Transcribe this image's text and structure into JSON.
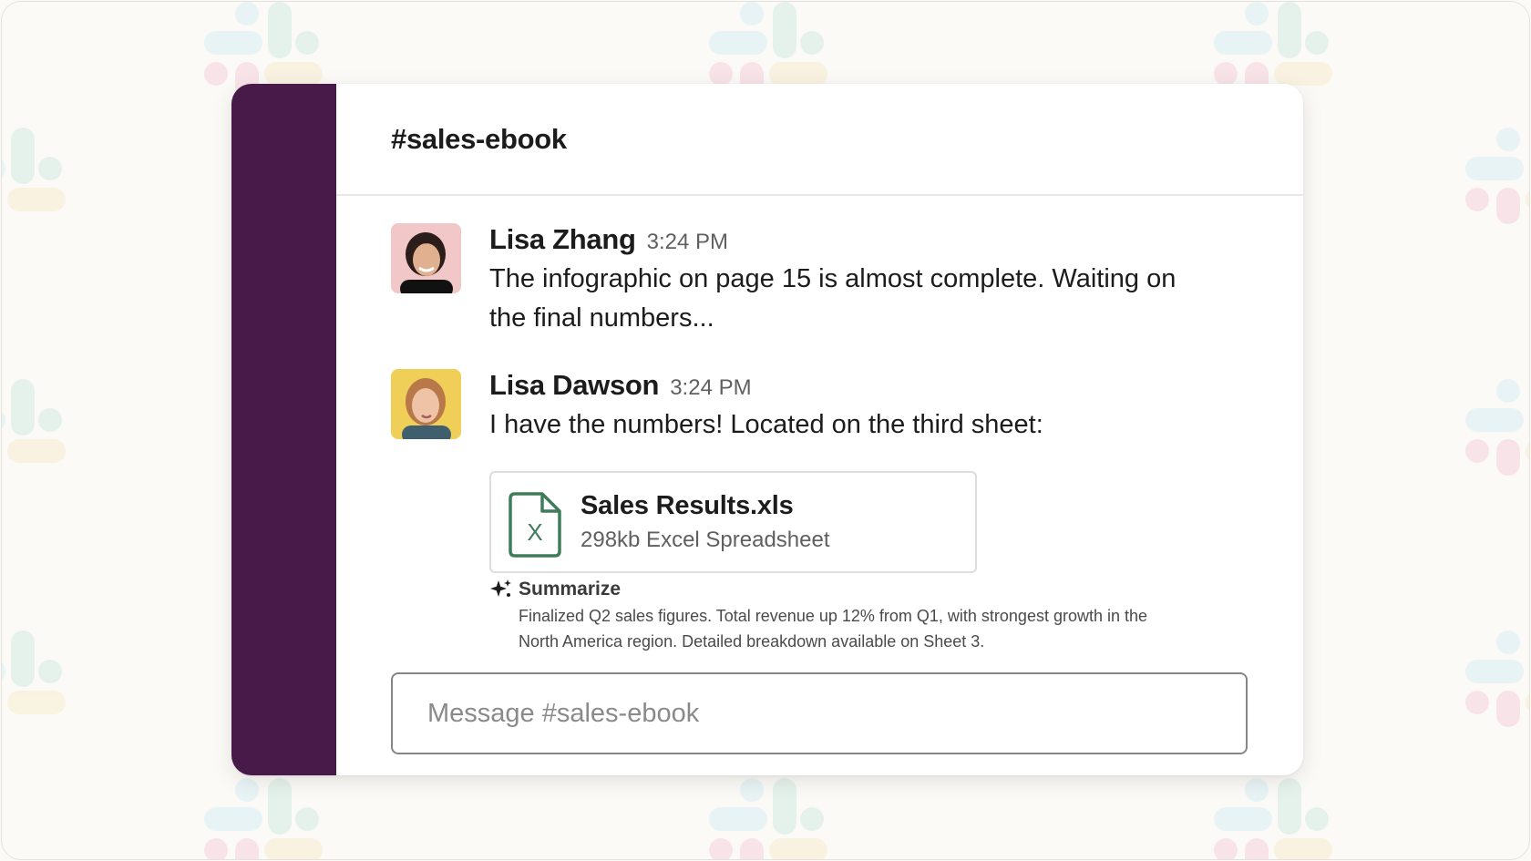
{
  "channel": {
    "name": "#sales-ebook"
  },
  "messages": [
    {
      "sender": "Lisa Zhang",
      "time": "3:24 PM",
      "text": "The infographic on page 15 is almost complete. Waiting on the final numbers..."
    },
    {
      "sender": "Lisa Dawson",
      "time": "3:24 PM",
      "text": "I have the numbers! Located on the third sheet:",
      "attachment": {
        "icon": "excel-file-icon",
        "icon_letter": "X",
        "name": "Sales Results.xls",
        "meta": "298kb Excel Spreadsheet"
      },
      "summary": {
        "icon": "sparkle-icon",
        "label": "Summarize",
        "text": "Finalized Q2 sales figures. Total revenue up 12% from Q1, with strongest growth in the North America region. Detailed breakdown available on Sheet 3."
      }
    }
  ],
  "composer": {
    "placeholder": "Message #sales-ebook"
  },
  "colors": {
    "sidebar": "#481a4a",
    "excel_green": "#3f7d5a",
    "background": "#fbfaf7"
  }
}
